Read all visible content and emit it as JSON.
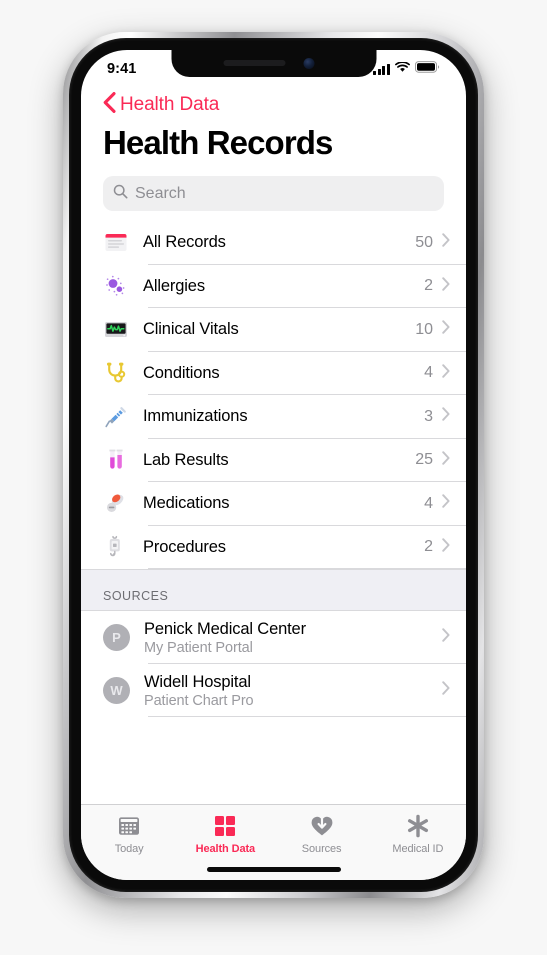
{
  "status_bar": {
    "time": "9:41",
    "signal_icon": "cellular-signal-icon",
    "wifi_icon": "wifi-icon",
    "battery_icon": "battery-full-icon"
  },
  "nav": {
    "back_label": "Health Data",
    "back_icon": "chevron-left-icon",
    "accent_color": "#fa2a56"
  },
  "page": {
    "title": "Health Records"
  },
  "search": {
    "placeholder": "Search",
    "value": "",
    "icon": "search-icon"
  },
  "records": [
    {
      "label": "All Records",
      "count": "50",
      "icon": "records-document-icon",
      "chevron": "chevron-right-icon"
    },
    {
      "label": "Allergies",
      "count": "2",
      "icon": "allergies-particles-icon",
      "chevron": "chevron-right-icon"
    },
    {
      "label": "Clinical Vitals",
      "count": "10",
      "icon": "vitals-monitor-icon",
      "chevron": "chevron-right-icon"
    },
    {
      "label": "Conditions",
      "count": "4",
      "icon": "stethoscope-icon",
      "chevron": "chevron-right-icon"
    },
    {
      "label": "Immunizations",
      "count": "3",
      "icon": "syringe-icon",
      "chevron": "chevron-right-icon"
    },
    {
      "label": "Lab Results",
      "count": "25",
      "icon": "test-tubes-icon",
      "chevron": "chevron-right-icon"
    },
    {
      "label": "Medications",
      "count": "4",
      "icon": "pills-icon",
      "chevron": "chevron-right-icon"
    },
    {
      "label": "Procedures",
      "count": "2",
      "icon": "iv-bag-icon",
      "chevron": "chevron-right-icon"
    }
  ],
  "sources": {
    "header": "SOURCES",
    "items": [
      {
        "title": "Penick Medical Center",
        "subtitle": "My Patient Portal",
        "initial": "P",
        "chevron": "chevron-right-icon"
      },
      {
        "title": "Widell Hospital",
        "subtitle": "Patient Chart Pro",
        "initial": "W",
        "chevron": "chevron-right-icon"
      }
    ]
  },
  "tab_bar": {
    "active_color": "#fa2a56",
    "inactive_color": "#8e8e93",
    "tabs": [
      {
        "label": "Today",
        "icon": "calendar-icon",
        "active": false
      },
      {
        "label": "Health Data",
        "icon": "health-grid-icon",
        "active": true
      },
      {
        "label": "Sources",
        "icon": "heart-download-icon",
        "active": false
      },
      {
        "label": "Medical ID",
        "icon": "medical-asterisk-icon",
        "active": false
      }
    ]
  }
}
